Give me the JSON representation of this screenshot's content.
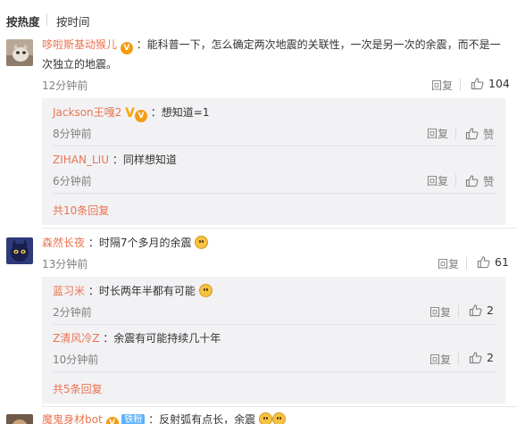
{
  "sort": {
    "active": "按热度",
    "inactive": "按时间"
  },
  "common": {
    "reply": "回复",
    "like": "赞"
  },
  "comments": [
    {
      "user": "哆啦斯基动猴儿",
      "line1": "：能科普一下，怎么确定两次地震的关联性，一次是另一次的余震，而不是一",
      "line2": "次独立的地震。",
      "time": "12分钟前",
      "likes": "104",
      "replies": [
        {
          "user": "Jackson王嘎2",
          "text": "：想知道=1",
          "time": "8分钟前",
          "likes": "赞"
        },
        {
          "user": "ZIHAN_LIU",
          "text": "：同样想知道",
          "time": "6分钟前",
          "likes": "赞"
        }
      ],
      "more": "共10条回复"
    },
    {
      "user": "森然长夜",
      "text": "：时隔7个多月的余震",
      "time": "13分钟前",
      "likes": "61",
      "replies": [
        {
          "user": "蓝习米",
          "text": "：时长两年半都有可能",
          "time": "2分钟前",
          "likes": "2"
        },
        {
          "user": "Z清风冷Z",
          "text": "：余震有可能持续几十年",
          "time": "10分钟前",
          "likes": "2"
        }
      ],
      "more": "共5条回复"
    },
    {
      "user": "魔鬼身材bot",
      "badge": "铁粉",
      "text": "：反射弧有点长，余震"
    }
  ],
  "colors": {
    "username": "#eb7350",
    "reply_bg": "#f2f2f5",
    "muted": "#808080"
  },
  "icons": [
    "thumb-up-icon",
    "vip-icon",
    "v-verified-icon",
    "emoji-icon"
  ]
}
